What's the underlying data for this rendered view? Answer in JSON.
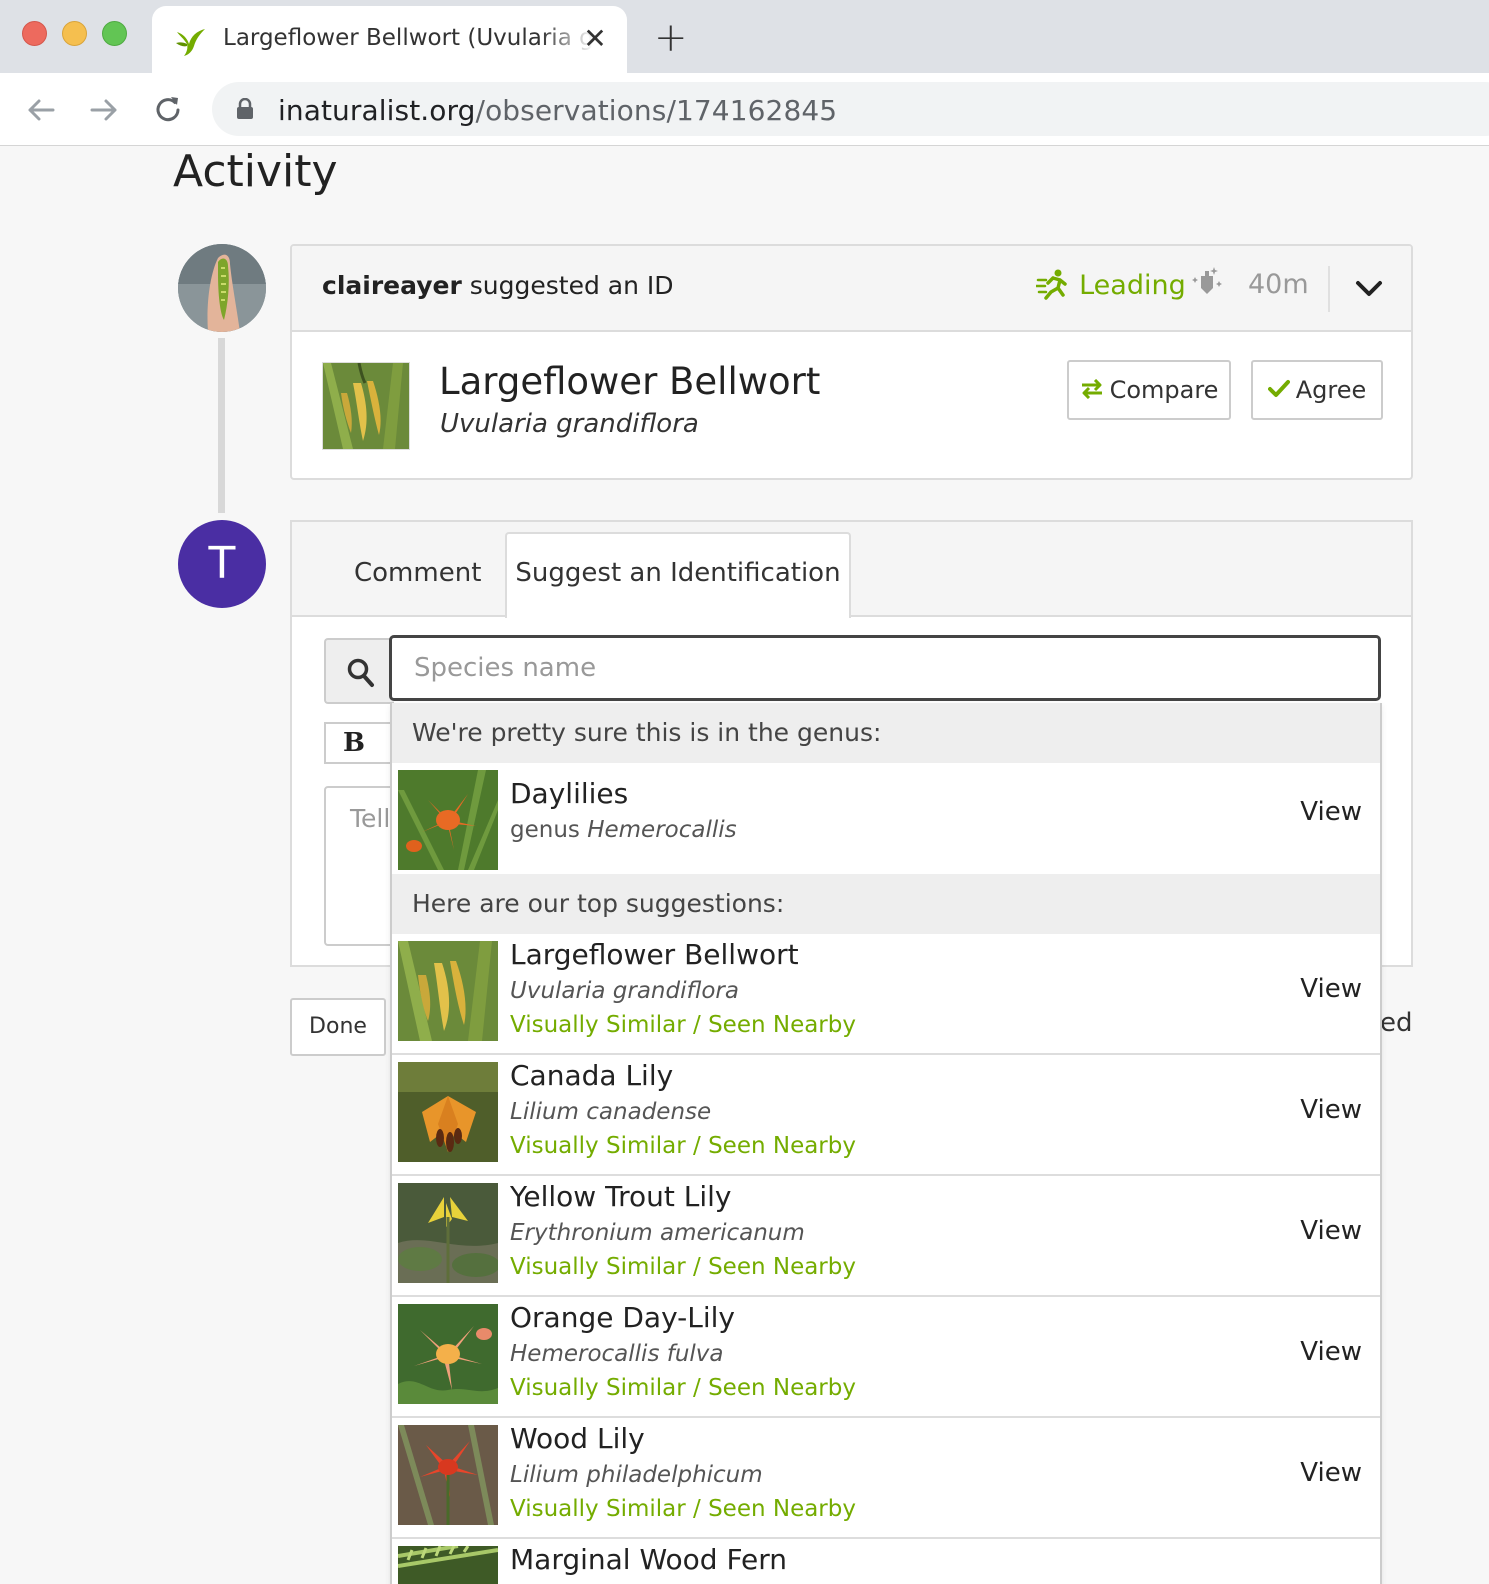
{
  "browser": {
    "tab_title": "Largeflower Bellwort (Uvularia grandiflora)",
    "url_host": "inaturalist.org",
    "url_path": "/observations/174162845"
  },
  "page": {
    "activity_title": "Activity",
    "identification": {
      "user": "claireayer",
      "action": "suggested an ID",
      "status": "Leading",
      "time_ago": "40m",
      "common_name": "Largeflower Bellwort",
      "scientific_name": "Uvularia grandiflora",
      "compare_label": "Compare",
      "agree_label": "Agree"
    },
    "current_user_initial": "T",
    "form": {
      "tab_comment": "Comment",
      "tab_suggest": "Suggest an Identification",
      "species_placeholder": "Species name",
      "bold_label": "B",
      "comment_placeholder": "Tell",
      "done_label": "Done",
      "peek_text": "ed"
    },
    "dropdown": {
      "genus_heading": "We're pretty sure this is in the genus:",
      "genus": {
        "common": "Daylilies",
        "rank": "genus",
        "scientific": "Hemerocallis",
        "view": "View"
      },
      "suggestions_heading": "Here are our top suggestions:",
      "suggestions": [
        {
          "common": "Largeflower Bellwort",
          "scientific": "Uvularia grandiflora",
          "reason": "Visually Similar / Seen Nearby",
          "view": "View"
        },
        {
          "common": "Canada Lily",
          "scientific": "Lilium canadense",
          "reason": "Visually Similar / Seen Nearby",
          "view": "View"
        },
        {
          "common": "Yellow Trout Lily",
          "scientific": "Erythronium americanum",
          "reason": "Visually Similar / Seen Nearby",
          "view": "View"
        },
        {
          "common": "Orange Day-Lily",
          "scientific": "Hemerocallis fulva",
          "reason": "Visually Similar / Seen Nearby",
          "view": "View"
        },
        {
          "common": "Wood Lily",
          "scientific": "Lilium philadelphicum",
          "reason": "Visually Similar / Seen Nearby",
          "view": "View"
        },
        {
          "common": "Marginal Wood Fern",
          "scientific": "",
          "reason": "",
          "view": ""
        }
      ]
    }
  },
  "colors": {
    "accent_green": "#74ac00",
    "avatar_purple": "#4a2ea3"
  }
}
